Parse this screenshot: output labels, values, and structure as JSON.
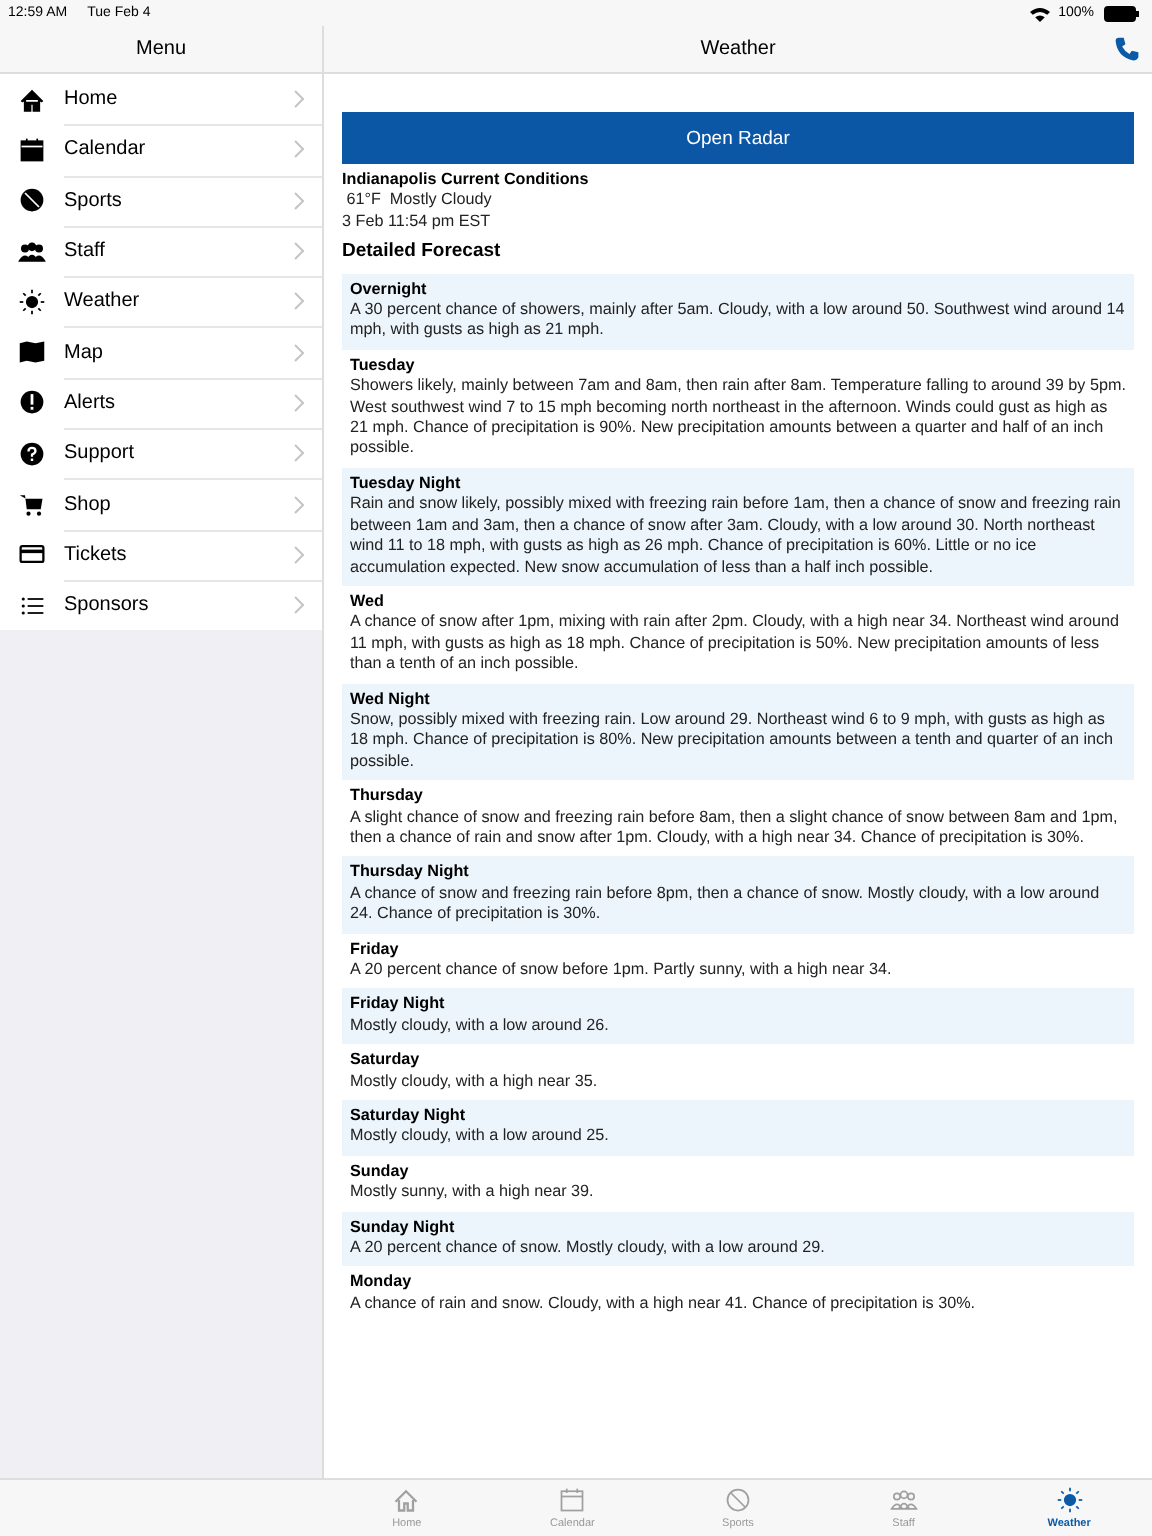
{
  "status_bar": {
    "time": "12:59 AM",
    "date": "Tue Feb 4",
    "battery": "100%"
  },
  "sidebar": {
    "title": "Menu",
    "items": [
      {
        "label": "Home"
      },
      {
        "label": "Calendar"
      },
      {
        "label": "Sports"
      },
      {
        "label": "Staff"
      },
      {
        "label": "Weather"
      },
      {
        "label": "Map"
      },
      {
        "label": "Alerts"
      },
      {
        "label": "Support"
      },
      {
        "label": "Shop"
      },
      {
        "label": "Tickets"
      },
      {
        "label": "Sponsors"
      }
    ]
  },
  "main": {
    "title": "Weather",
    "radar_button": "Open Radar",
    "conditions": {
      "title": "Indianapolis Current Conditions",
      "summary": " 61°F  Mostly Cloudy",
      "updated": "3 Feb 11:54 pm EST"
    },
    "forecast_title": "Detailed Forecast",
    "forecast": [
      {
        "period": "Overnight",
        "text": "A 30 percent chance of showers, mainly after 5am. Cloudy, with a low around 50. Southwest wind around 14 mph, with gusts as high as 21 mph."
      },
      {
        "period": "Tuesday",
        "text": "Showers likely, mainly between 7am and 8am, then rain after 8am. Temperature falling to around 39 by 5pm. West southwest wind 7 to 15 mph becoming north northeast in the afternoon. Winds could gust as high as 21 mph. Chance of precipitation is 90%. New precipitation amounts between a quarter and half of an inch possible."
      },
      {
        "period": "Tuesday Night",
        "text": "Rain and snow likely, possibly mixed with freezing rain before 1am, then a chance of snow and freezing rain between 1am and 3am, then a chance of snow after 3am. Cloudy, with a low around 30. North northeast wind 11 to 18 mph, with gusts as high as 26 mph. Chance of precipitation is 60%. Little or no ice accumulation expected. New snow accumulation of less than a half inch possible."
      },
      {
        "period": "Wed",
        "text": "A chance of snow after 1pm, mixing with rain after 2pm. Cloudy, with a high near 34. Northeast wind around 11 mph, with gusts as high as 18 mph. Chance of precipitation is 50%. New precipitation amounts of less than a tenth of an inch possible."
      },
      {
        "period": "Wed Night",
        "text": "Snow, possibly mixed with freezing rain. Low around 29. Northeast wind 6 to 9 mph, with gusts as high as 18 mph. Chance of precipitation is 80%. New precipitation amounts between a tenth and quarter of an inch possible."
      },
      {
        "period": "Thursday",
        "text": "A slight chance of snow and freezing rain before 8am, then a slight chance of snow between 8am and 1pm, then a chance of rain and snow after 1pm. Cloudy, with a high near 34. Chance of precipitation is 30%."
      },
      {
        "period": "Thursday Night",
        "text": "A chance of snow and freezing rain before 8pm, then a chance of snow. Mostly cloudy, with a low around 24. Chance of precipitation is 30%."
      },
      {
        "period": "Friday",
        "text": "A 20 percent chance of snow before 1pm. Partly sunny, with a high near 34."
      },
      {
        "period": "Friday Night",
        "text": "Mostly cloudy, with a low around 26."
      },
      {
        "period": "Saturday",
        "text": "Mostly cloudy, with a high near 35."
      },
      {
        "period": "Saturday Night",
        "text": "Mostly cloudy, with a low around 25."
      },
      {
        "period": "Sunday",
        "text": "Mostly sunny, with a high near 39."
      },
      {
        "period": "Sunday Night",
        "text": "A 20 percent chance of snow. Mostly cloudy, with a low around 29."
      },
      {
        "period": "Monday",
        "text": "A chance of rain and snow. Cloudy, with a high near 41. Chance of precipitation is 30%."
      }
    ]
  },
  "tab_bar": [
    {
      "label": "Home",
      "selected": false
    },
    {
      "label": "Calendar",
      "selected": false
    },
    {
      "label": "Sports",
      "selected": false
    },
    {
      "label": "Staff",
      "selected": false
    },
    {
      "label": "Weather",
      "selected": true
    }
  ]
}
